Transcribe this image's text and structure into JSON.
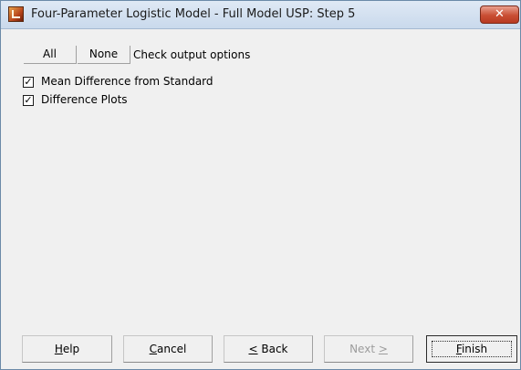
{
  "window": {
    "title": "Four-Parameter Logistic Model - Full Model USP: Step 5",
    "close_symbol": "✕"
  },
  "top_buttons": {
    "all": "All",
    "none": "None"
  },
  "hint": "Check output options",
  "options": [
    {
      "label": "Mean Difference from Standard",
      "checked": true
    },
    {
      "label": "Difference Plots",
      "checked": true
    }
  ],
  "footer": {
    "help": {
      "mnemonic": "H",
      "rest": "elp"
    },
    "cancel": {
      "mnemonic": "C",
      "rest": "ancel"
    },
    "back": {
      "mnemonic": "<",
      "rest": " Back"
    },
    "next": {
      "text": "Next ",
      "mnemonic": ">"
    },
    "finish": {
      "mnemonic": "F",
      "rest": "inish"
    }
  },
  "check_mark": "✓"
}
